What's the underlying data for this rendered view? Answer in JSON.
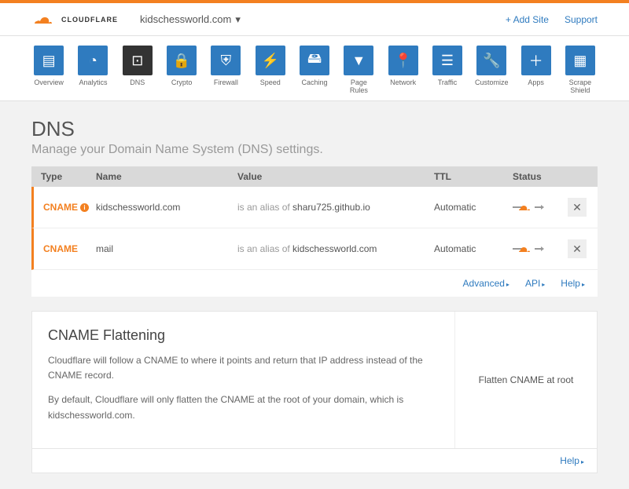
{
  "brand": "CLOUDFLARE",
  "domain": "kidschessworld.com",
  "header_links": {
    "add_site": "+ Add Site",
    "support": "Support"
  },
  "nav": [
    {
      "label": "Overview"
    },
    {
      "label": "Analytics"
    },
    {
      "label": "DNS"
    },
    {
      "label": "Crypto"
    },
    {
      "label": "Firewall"
    },
    {
      "label": "Speed"
    },
    {
      "label": "Caching"
    },
    {
      "label": "Page Rules"
    },
    {
      "label": "Network"
    },
    {
      "label": "Traffic"
    },
    {
      "label": "Customize"
    },
    {
      "label": "Apps"
    },
    {
      "label": "Scrape Shield"
    }
  ],
  "page": {
    "title": "DNS",
    "subtitle": "Manage your Domain Name System (DNS) settings."
  },
  "columns": {
    "type": "Type",
    "name": "Name",
    "value": "Value",
    "ttl": "TTL",
    "status": "Status"
  },
  "value_prefix": "is an alias of ",
  "records": [
    {
      "type": "CNAME",
      "info": true,
      "name": "kidschessworld.com",
      "value": "sharu725.github.io",
      "ttl": "Automatic"
    },
    {
      "type": "CNAME",
      "info": false,
      "name": "mail",
      "value": "kidschessworld.com",
      "ttl": "Automatic"
    }
  ],
  "footer_links": {
    "advanced": "Advanced",
    "api": "API",
    "help": "Help"
  },
  "flattening": {
    "title": "CNAME Flattening",
    "p1": "Cloudflare will follow a CNAME to where it points and return that IP address instead of the CNAME record.",
    "p2": "By default, Cloudflare will only flatten the CNAME at the root of your domain, which is kidschessworld.com.",
    "right": "Flatten CNAME at root",
    "help": "Help"
  }
}
